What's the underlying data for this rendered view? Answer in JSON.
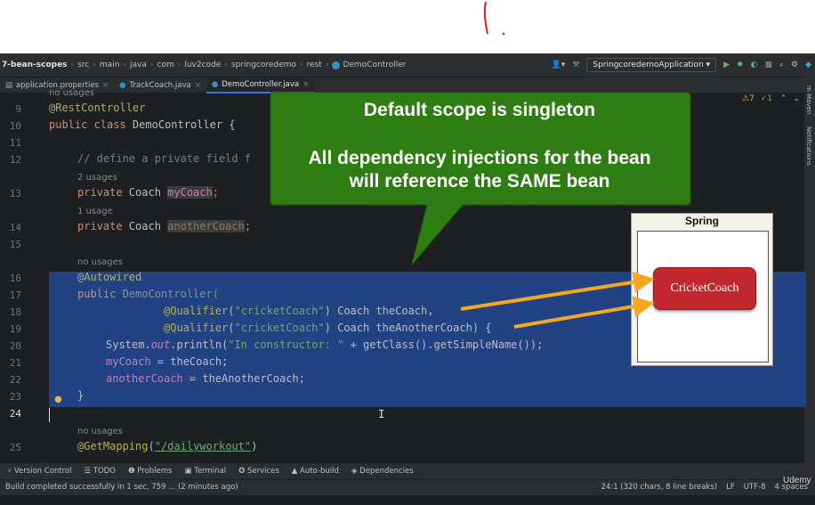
{
  "breadcrumb": {
    "project": "7-bean-scopes",
    "path": [
      "src",
      "main",
      "java",
      "com",
      "luv2code",
      "springcoredemo",
      "rest"
    ],
    "file": "DemoController"
  },
  "toolbar": {
    "run_config": "SpringcoredemoApplication"
  },
  "tabs": [
    {
      "label": "application.properties"
    },
    {
      "label": "TrackCoach.java"
    },
    {
      "label": "DemoController.java",
      "active": true
    }
  ],
  "inspections": {
    "warnings": "⚠7",
    "checks": "✓1"
  },
  "editor": {
    "line_numbers": [
      "9",
      "10",
      "11",
      "12",
      "13",
      "14",
      "15",
      "16",
      "17",
      "18",
      "19",
      "20",
      "21",
      "22",
      "23",
      "24",
      "25"
    ],
    "hints": {
      "top": "no usages",
      "u2": "2 usages",
      "u1": "1 usage",
      "nu1": "no usages",
      "nu2": "no usages"
    },
    "lines": {
      "l9": "@RestController",
      "l10_kw": "public class ",
      "l10_rest": "DemoController {",
      "l12": "// define a private field f",
      "l13_kw": "private ",
      "l13_type": "Coach ",
      "l13_field": "myCoach",
      "l14_field": "anotherCoach",
      "l16": "@Autowired",
      "l17_kw": "public ",
      "l17_name": "DemoController(",
      "l18_ann": "@Qualifier",
      "l18_str": "\"cricketCoach\"",
      "l18_rest": " Coach theCoach,",
      "l19_rest": " Coach theAnotherCoach) {",
      "l20_a": "System.",
      "l20_out": "out",
      "l20_b": ".println(",
      "l20_str": "\"In constructor: \"",
      "l20_c": " + getClass().getSimpleName());",
      "l21_field": "myCoach",
      "l21_rest": " = theCoach;",
      "l22_field": "anotherCoach",
      "l22_rest": " = theAnotherCoach;",
      "l23": "}",
      "l25_ann": "@GetMapping",
      "l25_str": "\"/dailyworkout\""
    }
  },
  "callout": {
    "title": "Default scope is singleton",
    "line1": "All dependency injections for the bean",
    "line2": "will reference the SAME bean",
    "color": "#2e7d12"
  },
  "diagram": {
    "container_label": "Spring",
    "bean_label": "CricketCoach",
    "bean_color": "#c1272d",
    "arrow_color": "#f5a623"
  },
  "bottom_tools": [
    "Version Control",
    "TODO",
    "Problems",
    "Terminal",
    "Services",
    "Auto-build",
    "Dependencies"
  ],
  "status": {
    "message": "Build completed successfully in 1 sec, 759 ... (2 minutes ago)",
    "position": "24:1 (320 chars, 8 line breaks)",
    "line_sep": "LF",
    "encoding": "UTF-8",
    "indent": "4 spaces",
    "watermark": "Udemy"
  }
}
